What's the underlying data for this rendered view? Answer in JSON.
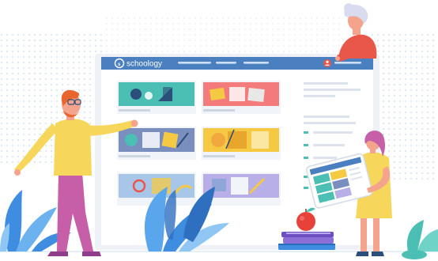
{
  "app": {
    "brand": "schoology"
  },
  "colors": {
    "header_bar": "#4a7fc0",
    "frame": "#eef1f6",
    "card_teal": "#4bbfb4",
    "card_pink": "#f47b7b",
    "card_slate": "#7b8fbf",
    "card_yellow": "#f6c942",
    "card_lightblue": "#a8c6e8",
    "card_lavender": "#b8aee8",
    "avatar": "#e8574a"
  },
  "icons": {
    "logo": "schoology-logo-icon",
    "user": "user-avatar-icon"
  }
}
